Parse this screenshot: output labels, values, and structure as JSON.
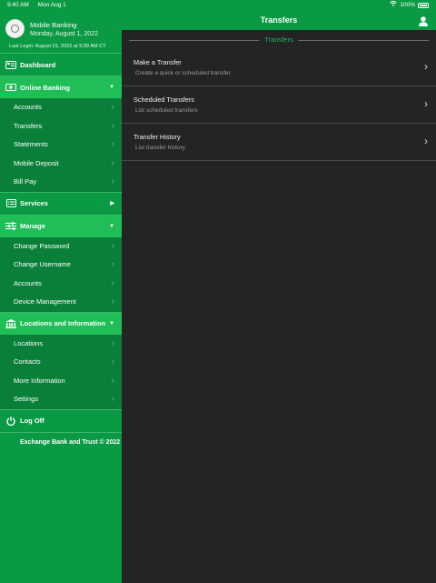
{
  "status_bar": {
    "time": "9:40 AM",
    "date": "Mon Aug 1",
    "battery": "100%"
  },
  "profile": {
    "name": "Mobile Banking",
    "date": "Monday, August 1, 2022",
    "last_login": "Last Login: August 01, 2022 at 9:39 AM CT"
  },
  "sidebar": {
    "dashboard": "Dashboard",
    "online_banking": {
      "label": "Online Banking",
      "items": [
        "Accounts",
        "Transfers",
        "Statements",
        "Mobile Deposit",
        "Bill Pay"
      ]
    },
    "services": "Services",
    "manage": {
      "label": "Manage",
      "items": [
        "Change Password",
        "Change Username",
        "Accounts",
        "Device Management"
      ]
    },
    "locations": {
      "label": "Locations and Information",
      "items": [
        "Locations",
        "Contacts",
        "More Information",
        "Settings"
      ]
    },
    "logoff": "Log Off",
    "footer": "Exchange Bank and Trust © 2022"
  },
  "header": {
    "title": "Transfers"
  },
  "main": {
    "section_title": "Transfers",
    "rows": [
      {
        "title": "Make a Transfer",
        "subtitle": "Create a quick or scheduled transfer"
      },
      {
        "title": "Scheduled Transfers",
        "subtitle": "List scheduled transfers"
      },
      {
        "title": "Transfer History",
        "subtitle": "List transfer history"
      }
    ]
  },
  "colors": {
    "brand_green": "#0b9a44",
    "active_green": "#1fbe57",
    "submenu_green": "#0a7f3a",
    "content_bg": "#242424",
    "accent_text": "#19b857"
  }
}
